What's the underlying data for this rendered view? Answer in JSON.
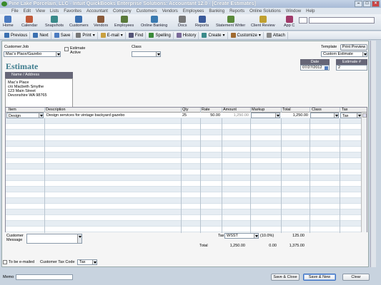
{
  "window": {
    "title": "Pine Lake Porcelain, LLC - Intuit QuickBooks Enterprise Solutions: Accountant 12.0 - [Create Estimates]"
  },
  "menu": [
    "File",
    "Edit",
    "View",
    "Lists",
    "Favorites",
    "Accountant",
    "Company",
    "Customers",
    "Vendors",
    "Employees",
    "Banking",
    "Reports",
    "Online Solutions",
    "Window",
    "Help"
  ],
  "iconbar": [
    "Home",
    "Calendar",
    "Snapshots",
    "Customers",
    "Vendors",
    "Employees",
    "Online Banking",
    "Docs",
    "Reports",
    "Statement Writer",
    "Client Review",
    "App C"
  ],
  "toolbar": {
    "previous": "Previous",
    "next": "Next",
    "save": "Save",
    "print": "Print",
    "email": "E-mail",
    "find": "Find",
    "spelling": "Spelling",
    "history": "History",
    "create": "Create",
    "customize": "Customize",
    "attach": "Attach"
  },
  "form": {
    "customer_label": "Customer:Job",
    "customer_value": "Mac's Place/Gazebo",
    "estimate_active": "Estimate Active",
    "class_label": "Class",
    "class_value": "",
    "template_label": "Template",
    "template_value": "Custom Estimate",
    "print_preview": "Print Preview",
    "title": "Estimate",
    "date_label": "Date",
    "date_value": "07/27/2012",
    "estnum_label": "Estimate #",
    "estnum_value": "2",
    "addr_label": "Name / Address",
    "addr_lines": [
      "Mac's Place",
      "c/o Macbeth Smythe",
      "123 Main Street",
      "Devonshire WA 98765"
    ]
  },
  "table": {
    "headers": [
      "Item",
      "Description",
      "Qty",
      "Rate",
      "Amount",
      "Markup",
      "Total",
      "Class",
      "Tax"
    ],
    "rows": [
      {
        "item": "Design",
        "description": "Design services for vintage backyard gazebo",
        "qty": "25",
        "rate": "50.00",
        "amount": "1,250.00",
        "markup": "",
        "total": "1,250.00",
        "class": "",
        "tax": "Tax"
      }
    ]
  },
  "footer": {
    "customer_msg_label": "Customer Message",
    "tax_label": "Tax",
    "tax_item": "WSST",
    "tax_rate": "(10.0%)",
    "tax_amount": "125.00",
    "total_label": "Total",
    "total_amount": "1,250.00",
    "total_markup": "0.00",
    "total_total": "1,375.00"
  },
  "bottom": {
    "to_be_emailed": "To be e-mailed",
    "cust_tax_code_label": "Customer Tax Code",
    "cust_tax_code": "Tax",
    "memo_label": "Memo",
    "save_close": "Save & Close",
    "save_new": "Save & New",
    "clear": "Clear"
  },
  "colors": {
    "accent": "#3f7d8e",
    "title_bar": "#b2c3db"
  }
}
